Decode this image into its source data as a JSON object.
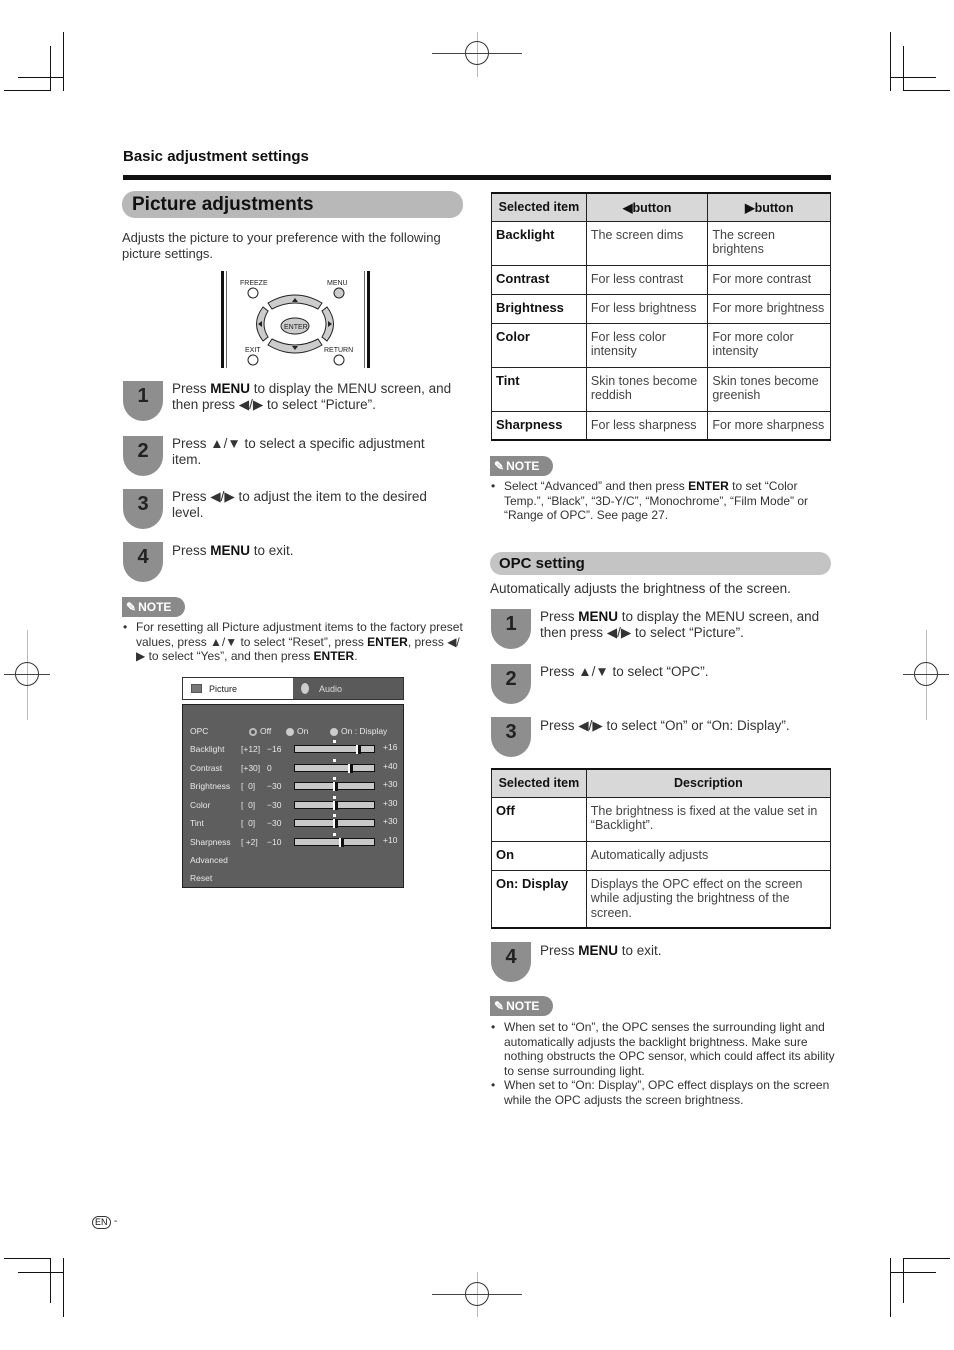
{
  "header": {
    "section_label": "Basic adjustment settings"
  },
  "picture_adjustments": {
    "title": "Picture adjustments",
    "intro": "Adjusts the picture to your preference with the following picture settings.",
    "remote": {
      "freeze": "FREEZE",
      "menu": "MENU",
      "enter": "ENTER",
      "exit": "EXIT",
      "return": "RETURN"
    },
    "steps": [
      {
        "number": "1",
        "pre": "Press ",
        "bold": "MENU",
        "post": " to display the MENU screen, and then press ◀/▶ to select “Picture”."
      },
      {
        "number": "2",
        "pre": "Press ▲/▼ to select a specific adjustment item.",
        "bold": "",
        "post": ""
      },
      {
        "number": "3",
        "pre": "Press ◀/▶ to adjust the item to the desired level.",
        "bold": "",
        "post": ""
      },
      {
        "number": "4",
        "pre": "Press ",
        "bold": "MENU",
        "post": " to exit."
      }
    ],
    "note": {
      "label": "NOTE",
      "items": [
        {
          "t1": "For resetting all Picture adjustment items to the factory preset values, press ▲/▼ to select “Reset”, press ",
          "b1": "ENTER",
          "t2": ", press ◀/▶ to select “Yes”, and then press ",
          "b2": "ENTER",
          "t3": "."
        }
      ]
    },
    "osd": {
      "tabs": [
        {
          "label": "Picture",
          "icon": "picture-icon",
          "active": true
        },
        {
          "label": "Audio",
          "icon": "audio-icon",
          "active": false
        }
      ],
      "opc": {
        "label": "OPC",
        "options": [
          "Off",
          "On",
          "On : Display"
        ],
        "selected": "Off"
      },
      "sliders": [
        {
          "label": "Backlight",
          "current": "[+12]",
          "min": "−16",
          "max": "+16",
          "value": 12,
          "range": [
            -16,
            16
          ]
        },
        {
          "label": "Contrast",
          "current": "[+30]",
          "min": "0",
          "max": "+40",
          "value": 30,
          "range": [
            0,
            40
          ]
        },
        {
          "label": "Brightness",
          "current": "[  0]",
          "min": "−30",
          "max": "+30",
          "value": 0,
          "range": [
            -30,
            30
          ]
        },
        {
          "label": "Color",
          "current": "[  0]",
          "min": "−30",
          "max": "+30",
          "value": 0,
          "range": [
            -30,
            30
          ]
        },
        {
          "label": "Tint",
          "current": "[  0]",
          "min": "−30",
          "max": "+30",
          "value": 0,
          "range": [
            -30,
            30
          ]
        },
        {
          "label": "Sharpness",
          "current": "[ +2]",
          "min": "−10",
          "max": "+10",
          "value": 2,
          "range": [
            -10,
            10
          ]
        }
      ],
      "links": [
        "Advanced",
        "Reset"
      ]
    }
  },
  "adjust_table": {
    "headers": [
      "Selected item",
      "◀button",
      "▶button"
    ],
    "rows": [
      [
        "Backlight",
        "The screen dims",
        "The screen brightens"
      ],
      [
        "Contrast",
        "For less contrast",
        "For more contrast"
      ],
      [
        "Brightness",
        "For less brightness",
        "For more brightness"
      ],
      [
        "Color",
        "For less color intensity",
        "For more color intensity"
      ],
      [
        "Tint",
        "Skin tones become reddish",
        "Skin tones become greenish"
      ],
      [
        "Sharpness",
        "For less sharpness",
        "For more sharpness"
      ]
    ]
  },
  "advanced_note": {
    "label": "NOTE",
    "t1": "Select “Advanced” and then press ",
    "b1": "ENTER",
    "t2": " to set “Color Temp.”, “Black”, “3D-Y/C”, “Monochrome”, “Film Mode” or “Range of OPC”. See page 27."
  },
  "opc_setting": {
    "title": "OPC setting",
    "intro": "Automatically adjusts the brightness of the screen.",
    "steps": [
      {
        "number": "1",
        "pre": "Press ",
        "bold": "MENU",
        "post": " to display the MENU screen, and then press ◀/▶ to select “Picture”."
      },
      {
        "number": "2",
        "pre": "Press ▲/▼ to select “OPC”.",
        "bold": "",
        "post": ""
      },
      {
        "number": "3",
        "pre": "Press ◀/▶ to select “On” or “On: Display”.",
        "bold": "",
        "post": ""
      },
      {
        "number": "4",
        "pre": "Press ",
        "bold": "MENU",
        "post": " to exit."
      }
    ],
    "table": {
      "headers": [
        "Selected item",
        "Description"
      ],
      "rows": [
        [
          "Off",
          "The brightness is fixed at the value set in “Backlight”."
        ],
        [
          "On",
          "Automatically adjusts"
        ],
        [
          "On: Display",
          "Displays the OPC effect on the screen while adjusting the brightness of the screen."
        ]
      ]
    },
    "note": {
      "label": "NOTE",
      "items": [
        "When set to “On”, the OPC senses the surrounding light and automatically adjusts the backlight brightness. Make sure nothing obstructs the OPC sensor, which could affect its ability to sense surrounding light.",
        "When set to “On: Display”, OPC effect displays on the screen while the OPC adjusts the screen brightness."
      ]
    }
  },
  "footer": {
    "language_mark": "EN",
    "page_suffix": "-"
  }
}
